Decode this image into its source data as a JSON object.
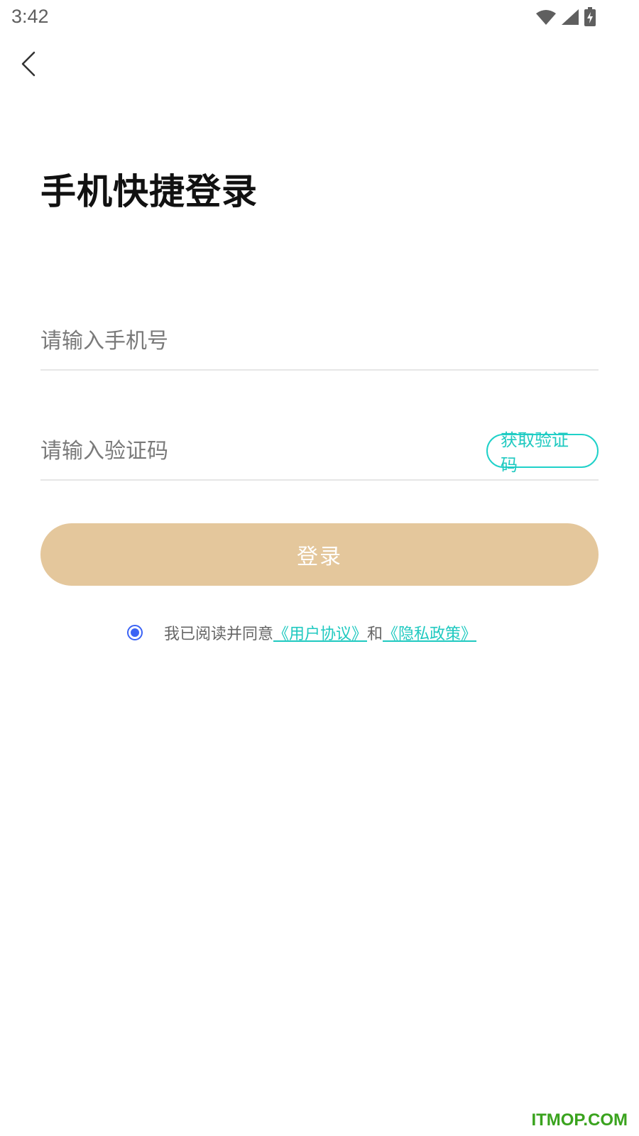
{
  "status_bar": {
    "time": "3:42",
    "icons": [
      "wifi-icon",
      "signal-icon",
      "battery-charging-icon"
    ]
  },
  "header": {
    "back_icon": "chevron-left-icon"
  },
  "main": {
    "title": "手机快捷登录",
    "phone_placeholder": "请输入手机号",
    "code_placeholder": "请输入验证码",
    "get_code_label": "获取验证码",
    "login_label": "登录"
  },
  "agreement": {
    "prefix": "我已阅读并同意",
    "user_agreement": "《用户协议》",
    "conjunction": "和",
    "privacy_policy": "《隐私政策》",
    "checked": true
  },
  "watermark": "ITMOP.COM",
  "colors": {
    "accent": "#1fc9c0",
    "login_button": "#e4c79c",
    "radio": "#3b63f5",
    "watermark": "#3aa31e"
  }
}
